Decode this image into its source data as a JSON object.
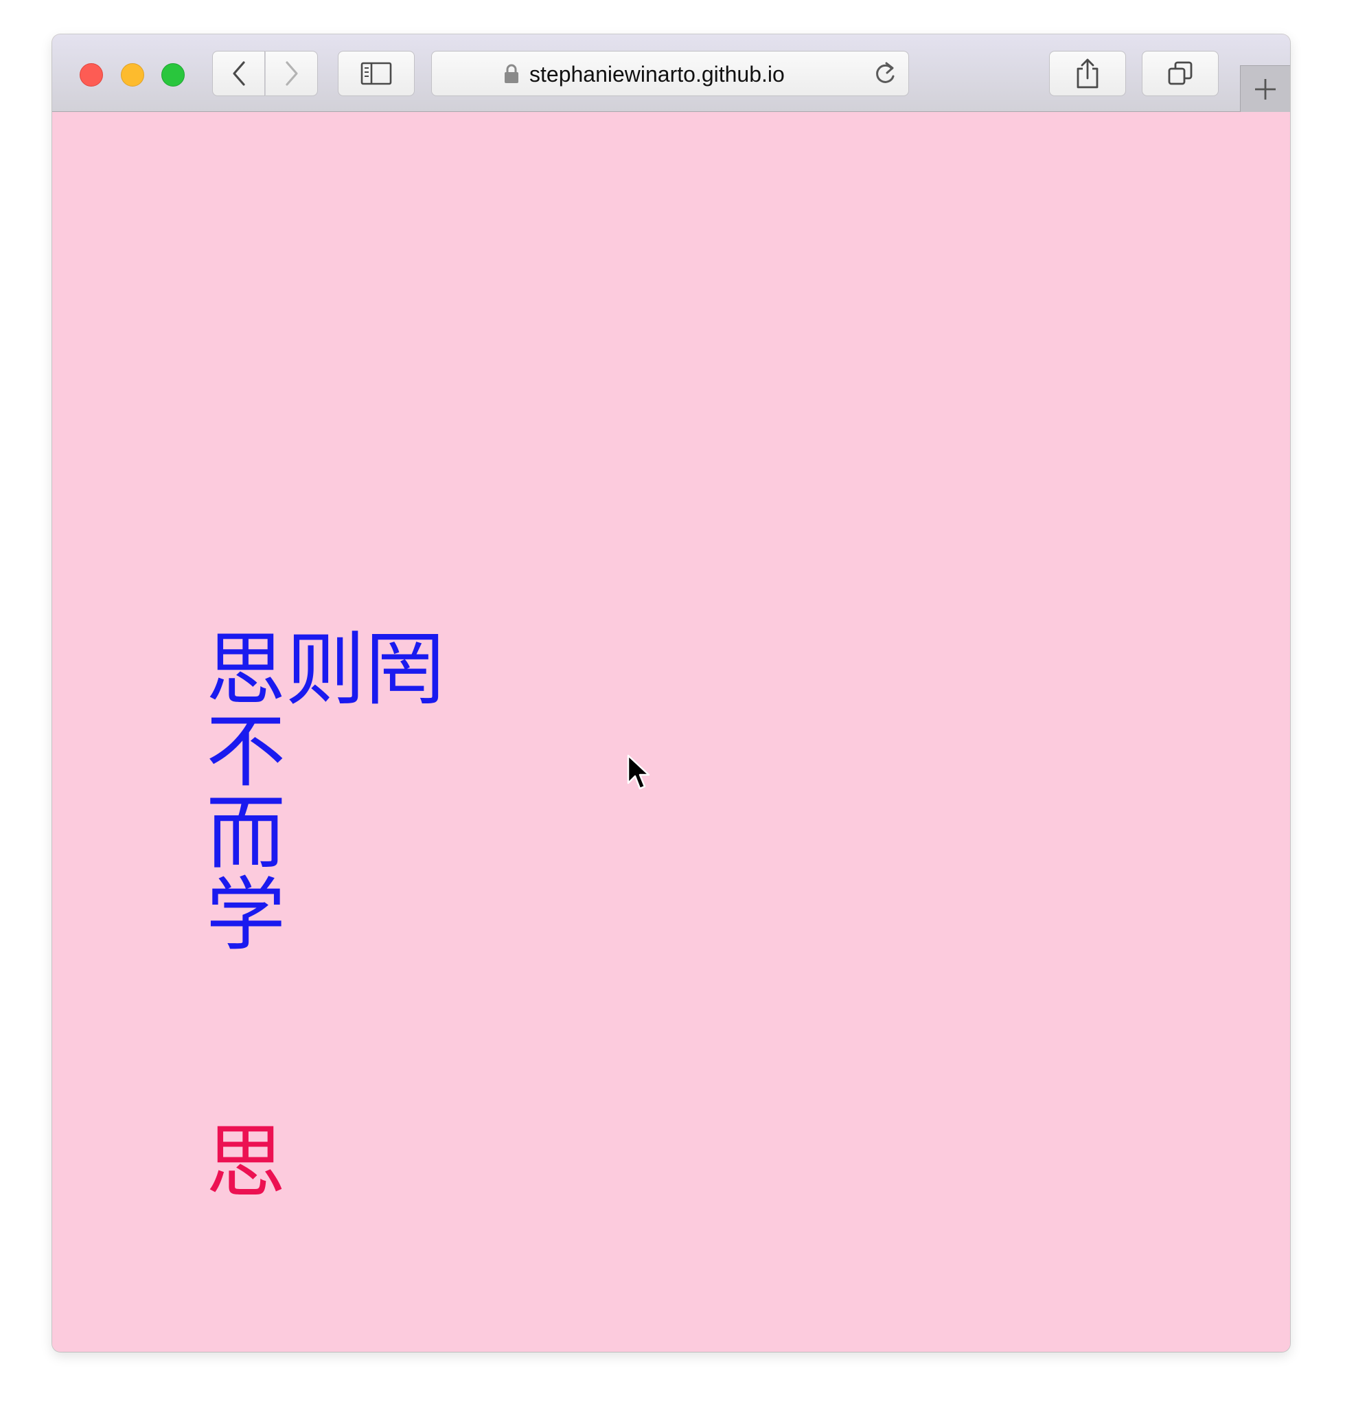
{
  "browser": {
    "url": "stephaniewinarto.github.io",
    "traffic_lights": [
      "close",
      "minimize",
      "zoom"
    ],
    "buttons": [
      "back",
      "forward",
      "sidebar",
      "share",
      "tabs-overview",
      "new-tab"
    ]
  },
  "page": {
    "background": "#fccbdd",
    "accent_blue": "#1a1aef",
    "accent_red": "#ec1152",
    "phrase_row": [
      "思",
      "则",
      "罔"
    ],
    "phrase_column": [
      "不",
      "而",
      "学"
    ],
    "highlight_char": "思"
  }
}
